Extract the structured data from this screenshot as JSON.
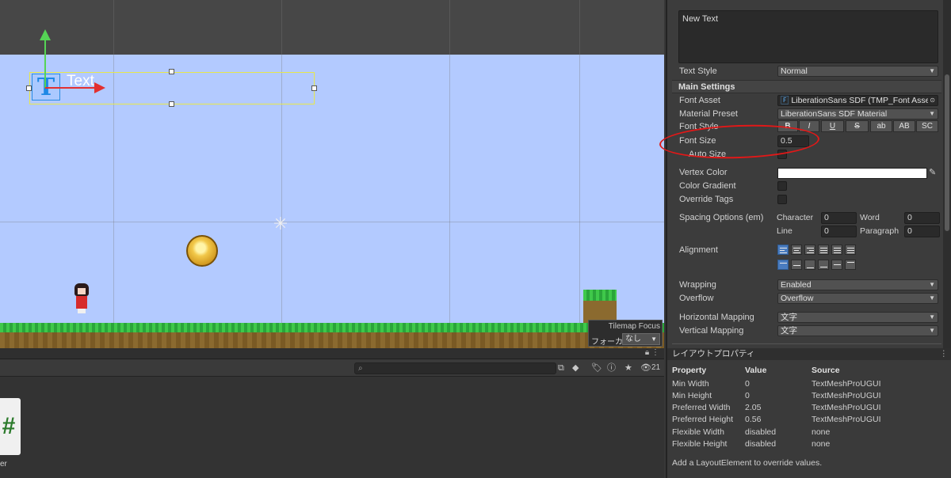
{
  "scene": {
    "text_object_label": "Text",
    "tilemap_overlay": {
      "title": "Tilemap Focus",
      "focus_label": "フォーカス",
      "focus_value": "なし"
    }
  },
  "project": {
    "search_value": "",
    "icons": [
      "lock-icon",
      "more-icon"
    ],
    "toolbar_count": "21",
    "file_label": "er"
  },
  "inspector": {
    "text_content": "New Text",
    "text_style": {
      "label": "Text Style",
      "value": "Normal"
    },
    "main_settings": "Main Settings",
    "font_asset": {
      "label": "Font Asset",
      "value": "LiberationSans SDF (TMP_Font Asse"
    },
    "material_preset": {
      "label": "Material Preset",
      "value": "LiberationSans SDF Material"
    },
    "font_style": {
      "label": "Font Style",
      "buttons": [
        "B",
        "I",
        "U",
        "S",
        "ab",
        "AB",
        "SC"
      ]
    },
    "font_size": {
      "label": "Font Size",
      "value": "0.5"
    },
    "auto_size": {
      "label": "Auto Size"
    },
    "vertex_color": {
      "label": "Vertex Color",
      "color": "#ffffff"
    },
    "color_gradient": {
      "label": "Color Gradient"
    },
    "override_tags": {
      "label": "Override Tags"
    },
    "spacing": {
      "label": "Spacing Options (em)",
      "character": {
        "label": "Character",
        "value": "0"
      },
      "word": {
        "label": "Word",
        "value": "0"
      },
      "line": {
        "label": "Line",
        "value": "0"
      },
      "paragraph": {
        "label": "Paragraph",
        "value": "0"
      }
    },
    "alignment": {
      "label": "Alignment"
    },
    "wrapping": {
      "label": "Wrapping",
      "value": "Enabled"
    },
    "overflow": {
      "label": "Overflow",
      "value": "Overflow"
    },
    "horizontal_mapping": {
      "label": "Horizontal Mapping",
      "value": "文字"
    },
    "vertical_mapping": {
      "label": "Vertical Mapping",
      "value": "文字"
    }
  },
  "layout_properties": {
    "title": "レイアウトプロパティ",
    "headers": [
      "Property",
      "Value",
      "Source"
    ],
    "rows": [
      [
        "Min Width",
        "0",
        "TextMeshProUGUI"
      ],
      [
        "Min Height",
        "0",
        "TextMeshProUGUI"
      ],
      [
        "Preferred Width",
        "2.05",
        "TextMeshProUGUI"
      ],
      [
        "Preferred Height",
        "0.56",
        "TextMeshProUGUI"
      ],
      [
        "Flexible Width",
        "disabled",
        "none"
      ],
      [
        "Flexible Height",
        "disabled",
        "none"
      ]
    ],
    "footer": "Add a LayoutElement to override values."
  }
}
